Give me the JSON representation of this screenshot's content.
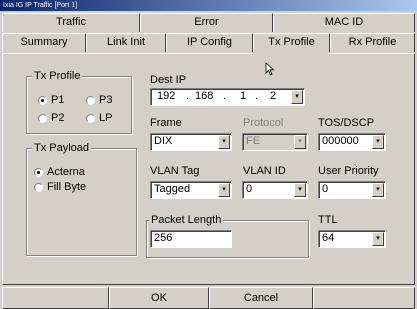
{
  "window": {
    "title": "Ixia IG IP Traffic [Port 1]"
  },
  "tabs_back": [
    "Traffic",
    "Error",
    "MAC ID"
  ],
  "tabs_front": [
    "Summary",
    "Link Init",
    "IP Config",
    "Tx Profile",
    "Rx Profile"
  ],
  "active_tab": "Tx Profile",
  "tx_profile": {
    "legend": "Tx Profile",
    "options": [
      "P1",
      "P3",
      "P2",
      "LP"
    ],
    "selected": "P1"
  },
  "tx_payload": {
    "legend": "Tx Payload",
    "options": [
      "Acterna",
      "Fill Byte"
    ],
    "selected": "Acterna"
  },
  "dest_ip": {
    "label": "Dest IP",
    "octets": [
      "192",
      "168",
      "1",
      "2"
    ],
    "sep": "."
  },
  "frame": {
    "label": "Frame",
    "value": "DIX"
  },
  "protocol": {
    "label": "Protocol",
    "value": "FE"
  },
  "tos": {
    "label": "TOS/DSCP",
    "value": "000000"
  },
  "vlan_tag": {
    "label": "VLAN Tag",
    "value": "Tagged"
  },
  "vlan_id": {
    "label": "VLAN ID",
    "value": "0"
  },
  "user_priority": {
    "label": "User Priority",
    "value": "0"
  },
  "packet_length": {
    "label": "Packet Length",
    "value": "256"
  },
  "ttl": {
    "label": "TTL",
    "value": "64"
  },
  "buttons": {
    "ok": "OK",
    "cancel": "Cancel"
  },
  "icons": {
    "dropdown": "▾"
  }
}
